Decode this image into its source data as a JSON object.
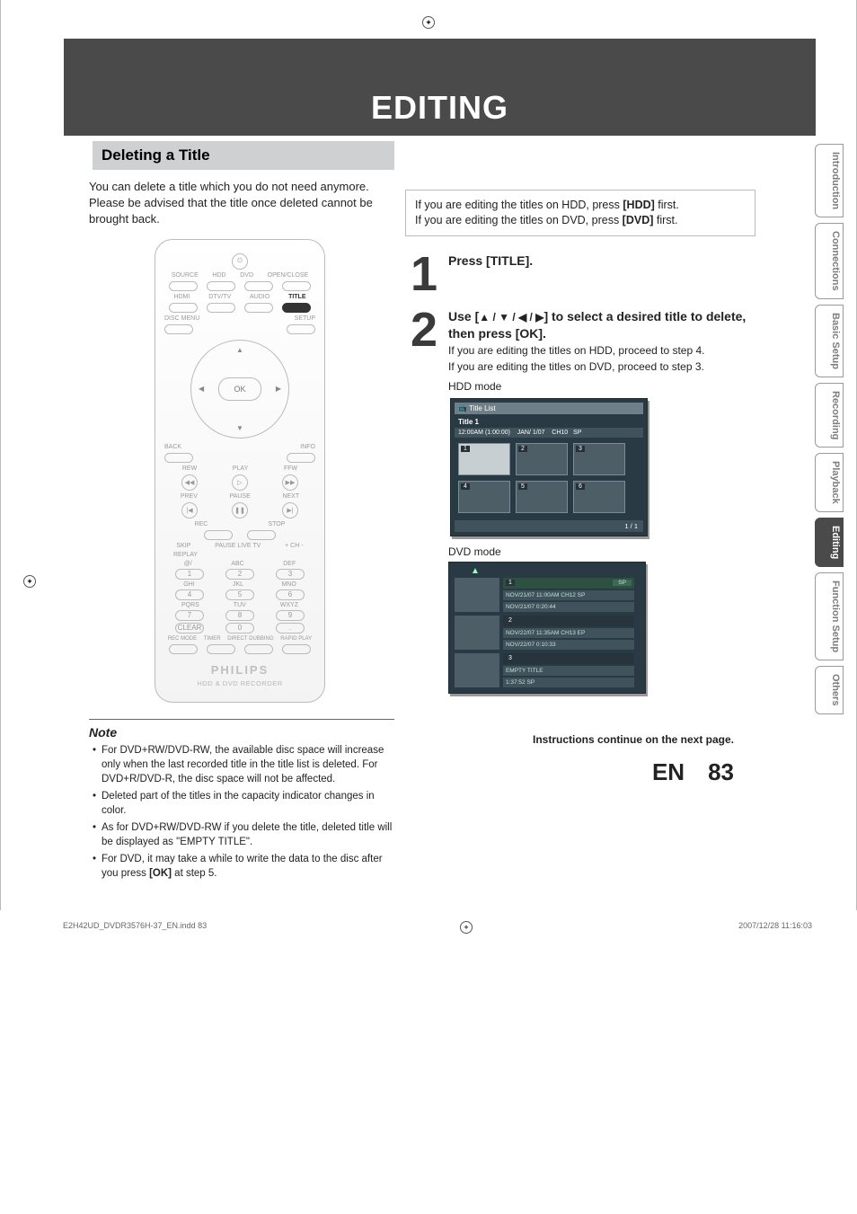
{
  "page_header_blank": "",
  "main_title": "EDITING",
  "subheading": "Deleting a Title",
  "intro_paragraph": "You can delete a title which you do not need anymore. Please be advised that the title once deleted cannot be brought back.",
  "hint_box_line1_pre": "If you are editing the titles on HDD, press ",
  "hint_box_line1_bold": "[HDD]",
  "hint_box_line1_post": " first.",
  "hint_box_line2_pre": "If you are editing the titles on DVD, press ",
  "hint_box_line2_bold": "[DVD]",
  "hint_box_line2_post": " first.",
  "step1_num": "1",
  "step1_title": "Press [TITLE].",
  "step2_num": "2",
  "step2_title_pre": "Use [",
  "step2_arrows": "▲ / ▼ / ◀ / ▶",
  "step2_title_post": "] to select a desired title to delete, then press [OK].",
  "step2_text1": "If you are editing the titles on HDD, proceed to step 4.",
  "step2_text2": "If you are editing the titles on DVD, proceed to step 3.",
  "hdd_mode_label": "HDD mode",
  "screen_header_icon_label": "Title List",
  "screen_title_label": "Title 1",
  "screen_meta_time": "12:00AM (1:00:00)",
  "screen_meta_date": "JAN/ 1/07",
  "screen_meta_ch": "CH10",
  "screen_meta_sp": "SP",
  "screen_thumb_1": "1",
  "screen_thumb_2": "2",
  "screen_thumb_3": "3",
  "screen_thumb_4": "4",
  "screen_thumb_5": "5",
  "screen_thumb_6": "6",
  "screen_footer": "1 / 1",
  "dvd_mode_label": "DVD mode",
  "s2_tri": "▲",
  "s2_item1_num": "1",
  "s2_item1_sp": "SP",
  "s2_item1_line1": "NOV/21/07  11:00AM CH12  SP",
  "s2_item1_line2": "NOV/21/07   0:20:44",
  "s2_item2_num": "2",
  "s2_item2_line1": "NOV/22/07  11:35AM CH13  EP",
  "s2_item2_line2": "NOV/22/07   0:10:33",
  "s2_item3_num": "3",
  "s2_item3_line1": "EMPTY TITLE",
  "s2_item3_line2": "1:37:52  SP",
  "side_tabs": {
    "t1": "Introduction",
    "t2": "Connections",
    "t3": "Basic Setup",
    "t4": "Recording",
    "t5": "Playback",
    "t6": "Editing",
    "t7": "Function Setup",
    "t8": "Others"
  },
  "remote": {
    "row1": {
      "a": "SOURCE",
      "b": "HDD",
      "c": "DVD",
      "d": "OPEN/CLOSE"
    },
    "row2": {
      "a": "HDMI",
      "b": "DTV/TV",
      "c": "AUDIO",
      "d": "TITLE"
    },
    "row3": {
      "a": "DISC MENU",
      "b": "SETUP"
    },
    "ok": "OK",
    "row5": {
      "a": "BACK",
      "b": "INFO"
    },
    "row6": {
      "a": "REW",
      "b": "PLAY",
      "c": "FFW"
    },
    "row7": {
      "a": "PREV",
      "b": "PAUSE",
      "c": "NEXT"
    },
    "row8": {
      "a": "REC",
      "b": "STOP"
    },
    "row9": {
      "a": "SKIP",
      "b": "PAUSE LIVE TV",
      "c": "+ CH -"
    },
    "row10": {
      "a": "REPLAY"
    },
    "np": [
      "1",
      "2",
      "3",
      "4",
      "5",
      "6",
      "7",
      "8",
      "9",
      "0"
    ],
    "np_labels": {
      "r1a": "@/",
      "r1b": "ABC",
      "r1c": "DEF",
      "r2a": "GHI",
      "r2b": "JKL",
      "r2c": "MNO",
      "r3a": "PQRS",
      "r3b": "TUV",
      "r3c": "WXYZ"
    },
    "clear": "CLEAR",
    "dot": ".",
    "row_bottom": {
      "a": "REC MODE",
      "b": "TIMER",
      "c": "DIRECT DUBBING",
      "d": "RAPID PLAY"
    },
    "brand": "PHILIPS",
    "brand_sub": "HDD & DVD RECORDER"
  },
  "note_heading": "Note",
  "note1_pre": "For DVD+RW/DVD-RW, the available disc space will increase only when the last recorded title in the title list is deleted. For DVD+R/DVD-R, the disc space will not be affected.",
  "note2": "Deleted part of the titles in the capacity indicator changes in color.",
  "note3": "As for DVD+RW/DVD-RW if you delete the title, deleted title will be displayed as \"EMPTY TITLE\".",
  "note4_pre": "For DVD, it may take a while to write the data to the disc after you press ",
  "note4_bold": "[OK]",
  "note4_post": " at step 5.",
  "continue_msg": "Instructions continue on the next page.",
  "page_en": "EN",
  "page_number": "83",
  "footer_left": "E2H42UD_DVDR3576H-37_EN.indd   83",
  "footer_right": "2007/12/28   11:16:03"
}
